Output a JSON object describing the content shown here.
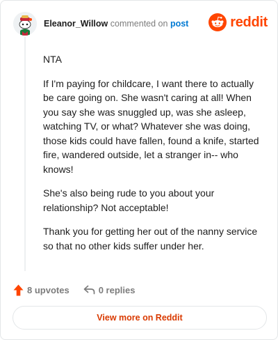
{
  "comment": {
    "author": "Eleanor_Willow",
    "commented_on": "commented on",
    "post_link": "post",
    "paragraphs": [
      "NTA",
      "If I'm paying for childcare, I want there to actually be care going on. She wasn't caring at all! When you say she was snuggled up, was she asleep, watching TV, or what? Whatever she was doing, those kids could have fallen, found a knife, started fire, wandered outside, let a stranger in-- who knows!",
      "She's also being rude to you about your relationship? Not acceptable!",
      "Thank you for getting her out of the nanny service so that no other kids suffer under her."
    ]
  },
  "brand": {
    "name": "reddit",
    "color": "#ff4500"
  },
  "actions": {
    "upvotes": "8 upvotes",
    "replies": "0 replies"
  },
  "view_more_label": "View more on Reddit",
  "icons": {
    "avatar": "snoo-avatar-icon",
    "logo": "reddit-logo-icon",
    "upvote": "upvote-arrow-icon",
    "reply": "reply-arrow-icon"
  }
}
